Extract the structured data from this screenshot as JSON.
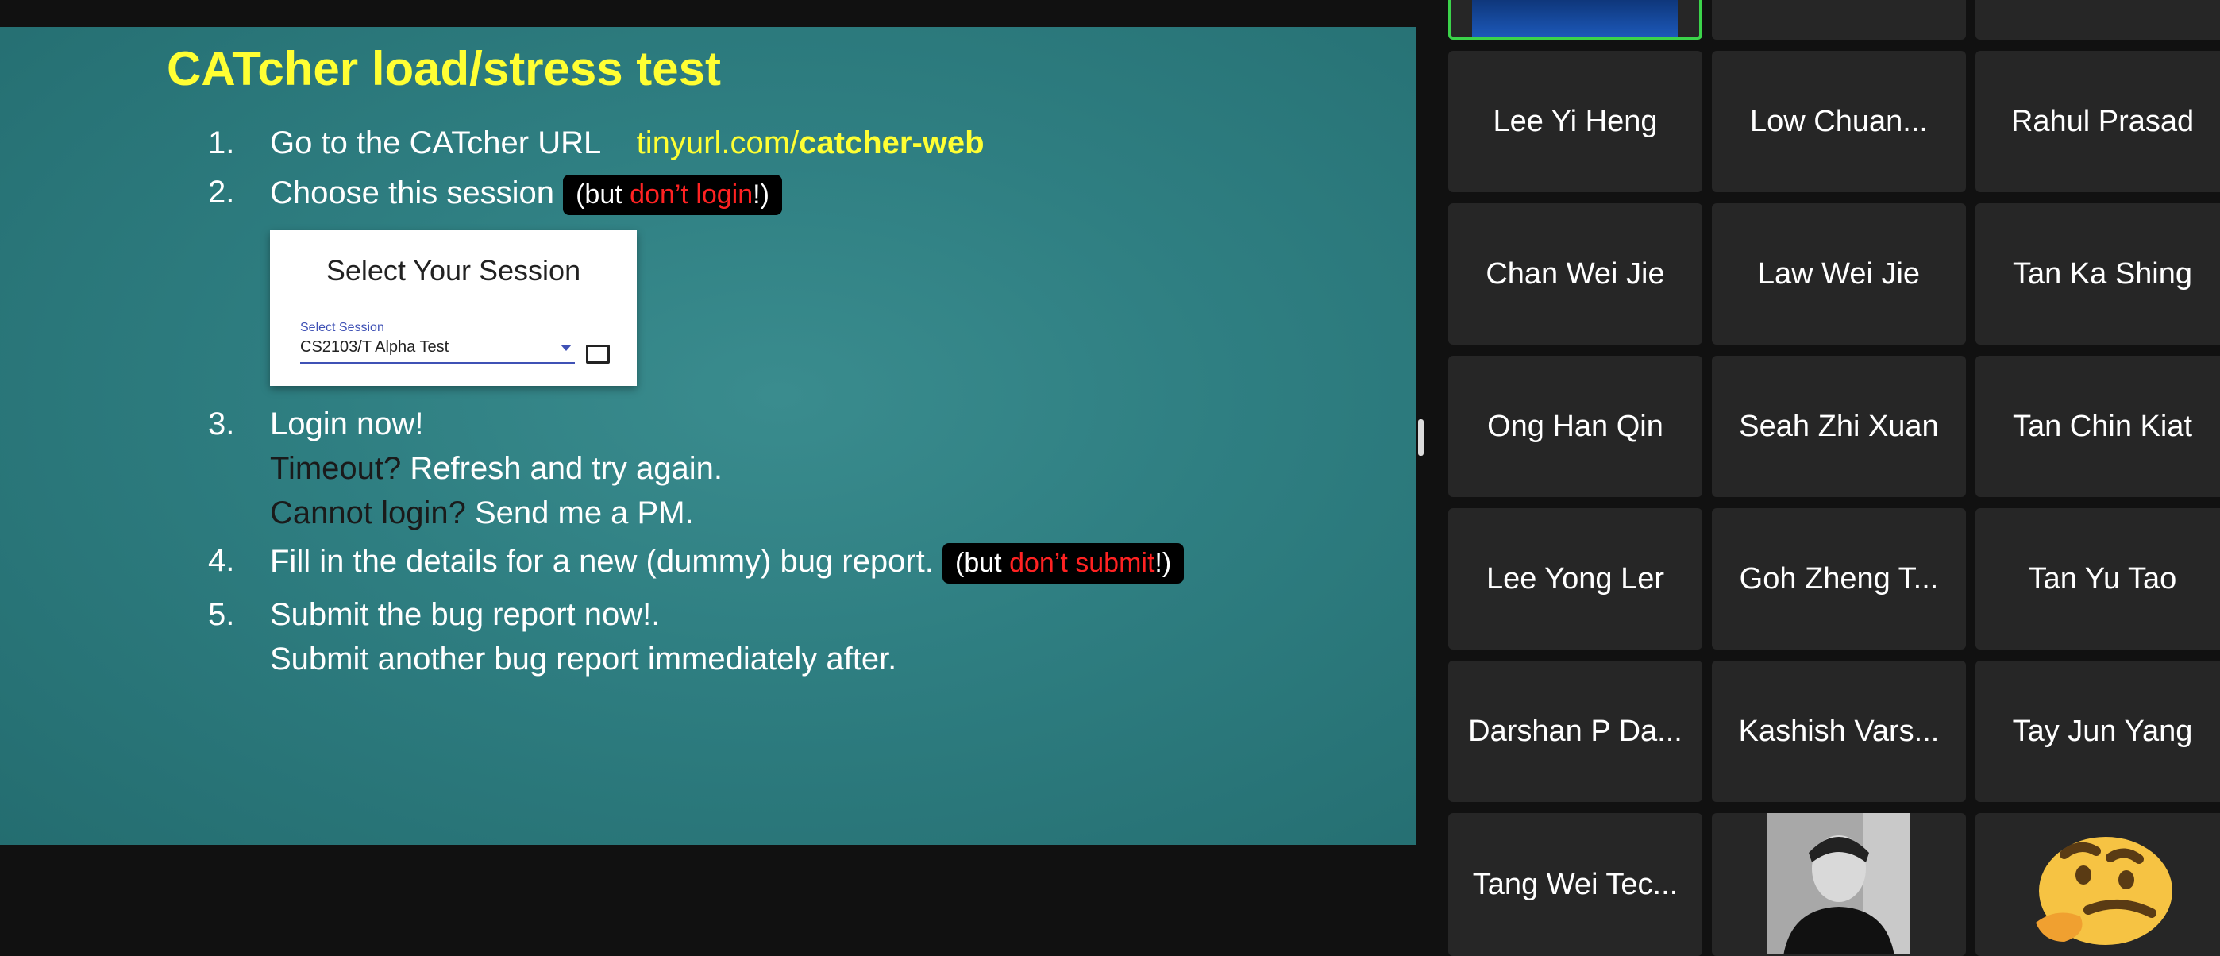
{
  "slide": {
    "title": "CATcher load/stress test",
    "items": [
      {
        "num": "1.",
        "text": "Go to the CATcher URL",
        "link_prefix": "tinyurl.com/",
        "link_bold": "catcher-web"
      },
      {
        "num": "2.",
        "text": "Choose this session",
        "pill_pre": "(but ",
        "pill_red": "don’t login",
        "pill_post": "!)"
      },
      {
        "num": "3.",
        "line1": "Login now!",
        "line2_dark": "Timeout?",
        "line2_rest": " Refresh and try again.",
        "line3_dark": "Cannot login?",
        "line3_rest": " Send me a PM."
      },
      {
        "num": "4.",
        "text": "Fill in the details for a new (dummy) bug report.",
        "pill_pre": "(but ",
        "pill_red": "don’t submit",
        "pill_post": "!)"
      },
      {
        "num": "5.",
        "line1": "Submit the bug report now!.",
        "line2": "Submit another bug report immediately after."
      }
    ],
    "session_card": {
      "title": "Select Your Session",
      "label": "Select Session",
      "value": "CS2103/T Alpha Test"
    }
  },
  "participants": [
    {
      "name": "Lee Yi Heng"
    },
    {
      "name": "Low Chuan..."
    },
    {
      "name": "Rahul Prasad"
    },
    {
      "name": "Chan Wei Jie"
    },
    {
      "name": "Law Wei Jie"
    },
    {
      "name": "Tan Ka Shing"
    },
    {
      "name": "Ong Han Qin"
    },
    {
      "name": "Seah Zhi Xuan"
    },
    {
      "name": "Tan Chin Kiat"
    },
    {
      "name": "Lee Yong Ler"
    },
    {
      "name": "Goh Zheng T..."
    },
    {
      "name": "Tan Yu Tao"
    },
    {
      "name": "Darshan P Da..."
    },
    {
      "name": "Kashish Vars..."
    },
    {
      "name": "Tay Jun Yang"
    },
    {
      "name": "Tang Wei Tec..."
    }
  ],
  "colors": {
    "active_speaker": "#3bd34a",
    "title_yellow": "#ffff33",
    "warning_red": "#ff2222"
  }
}
